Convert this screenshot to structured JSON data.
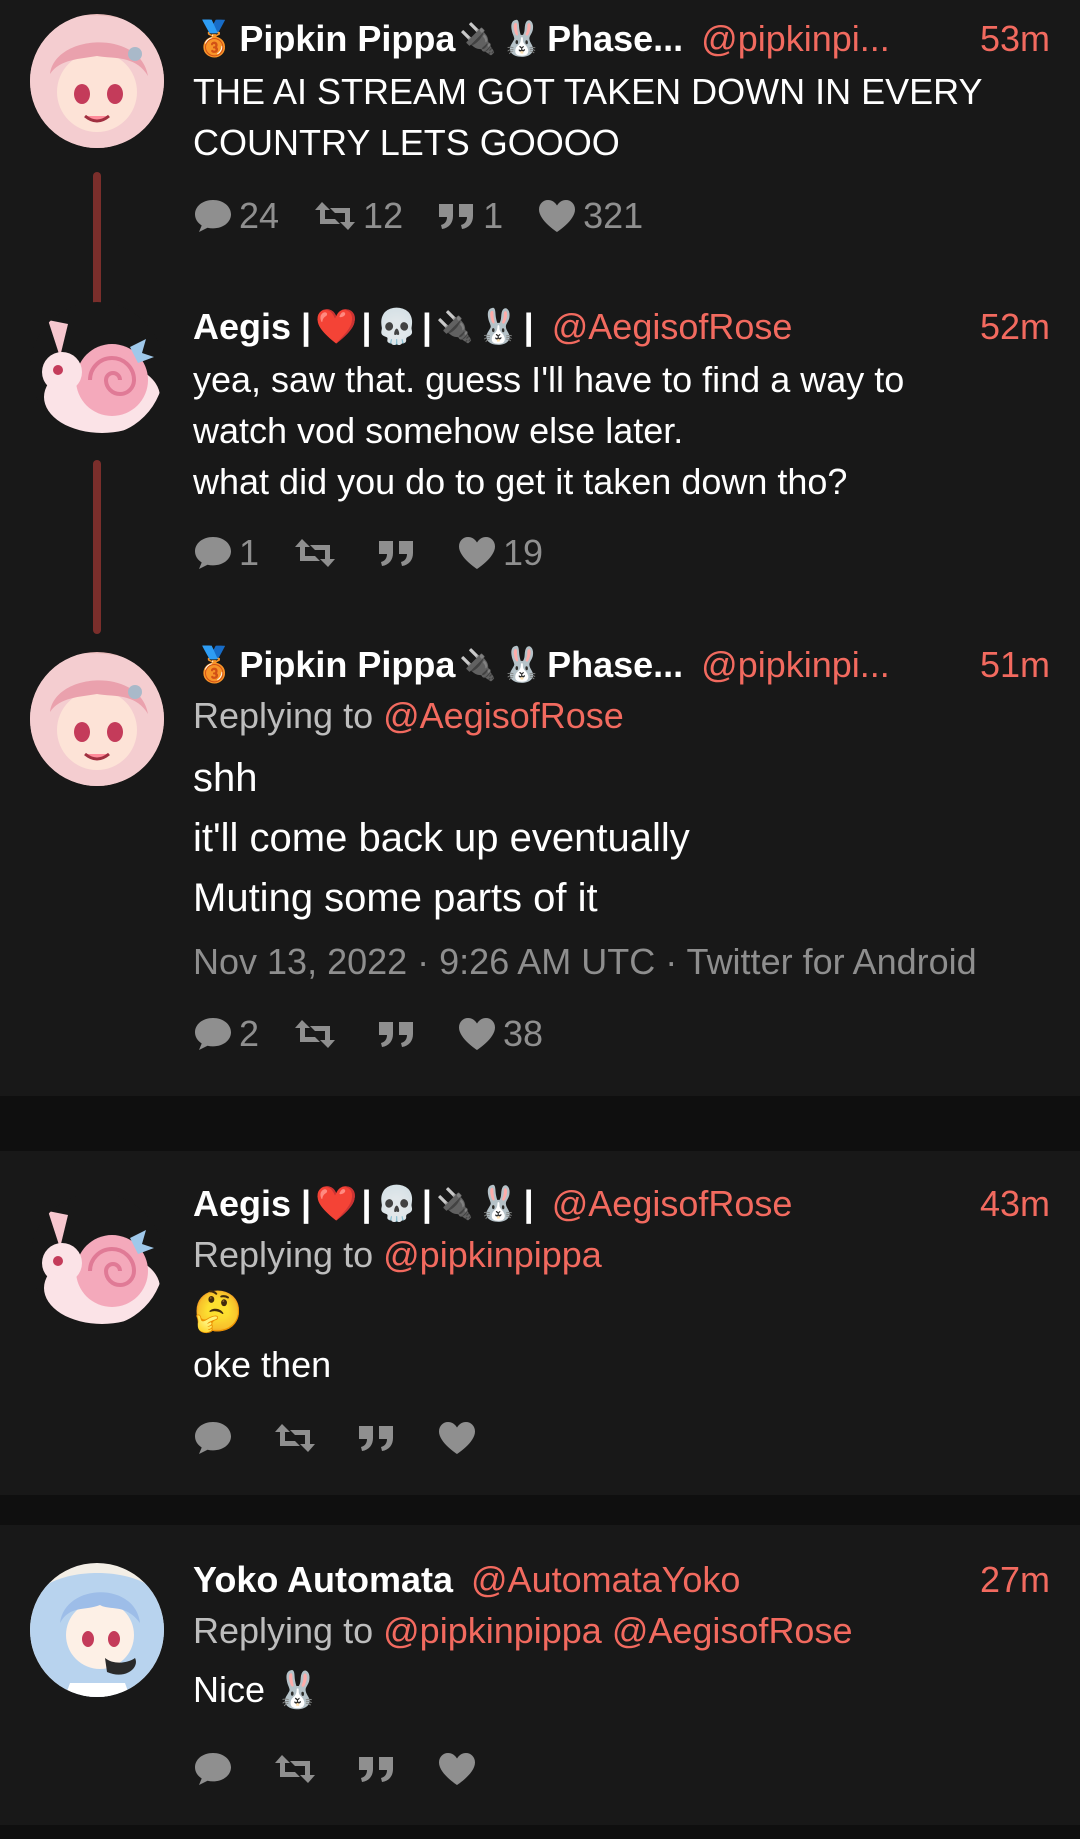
{
  "tweets": [
    {
      "name": "Pipkin Pippa",
      "name_suffix": "Phase...",
      "handle": "@pipkinpi...",
      "time": "53m",
      "text": "THE AI STREAM GOT TAKEN DOWN IN EVERY\nCOUNTRY LETS GOOOO",
      "replies": "24",
      "retweets": "12",
      "quotes": "1",
      "likes": "321"
    },
    {
      "name": "Aegis |",
      "name_mid": "|",
      "name_end": "|",
      "handle": "@AegisofRose",
      "time": "52m",
      "text": "yea, saw that. guess I'll have to find a way to\nwatch vod somehow else later.\nwhat did you do to get it taken down tho?",
      "replies": "1",
      "retweets": "",
      "quotes": "",
      "likes": "19"
    },
    {
      "name": "Pipkin Pippa",
      "name_suffix": "Phase...",
      "handle": "@pipkinpi...",
      "time": "51m",
      "replying_label": "Replying to",
      "replying_to": "@AegisofRose",
      "text": "shh\nit'll come back up eventually\nMuting some parts of it",
      "meta": "Nov 13, 2022 · 9:26 AM UTC · Twitter for Android",
      "replies": "2",
      "retweets": "",
      "quotes": "",
      "likes": "38"
    },
    {
      "name": "Aegis |",
      "name_mid": "|",
      "name_end": "|",
      "handle": "@AegisofRose",
      "time": "43m",
      "replying_label": "Replying to",
      "replying_to": "@pipkinpippa",
      "emoji": "🤔",
      "text": "oke then",
      "replies": "",
      "retweets": "",
      "quotes": "",
      "likes": ""
    },
    {
      "name": "Yoko Automata",
      "handle": "@AutomataYoko",
      "time": "27m",
      "replying_label": "Replying to",
      "replying_to": "@pipkinpippa @AegisofRose",
      "text": "Nice 🐰",
      "replies": "",
      "retweets": "",
      "quotes": "",
      "likes": ""
    }
  ],
  "colors": {
    "accent": "#f26a5f",
    "thread_line": "#7a2e2b",
    "card_bg": "#181818",
    "page_bg": "#0f0f0f",
    "muted": "#8f8f8f"
  },
  "icons": {
    "medal": "3rd-place-medal-icon",
    "plug": "electric-plug-icon",
    "bunny": "rabbit-face-icon",
    "heart": "red-heart-icon",
    "skull": "skull-icon"
  }
}
